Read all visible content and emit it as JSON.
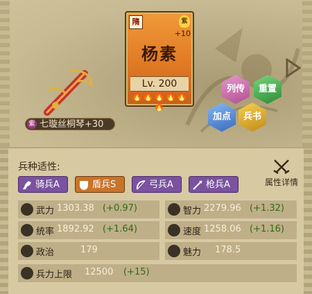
{
  "card": {
    "faction": "隋",
    "rank_badge": "紫",
    "plus": "+10",
    "name": "杨素",
    "level": "Lv. 200",
    "flames": "🔥🔥🔥🔥🔥🔥"
  },
  "equipment": {
    "badge": "紫",
    "name": "七璇丝桐琴+30"
  },
  "actions": {
    "biography": "列传",
    "reset": "重置",
    "add_points": "加点",
    "military_book": "兵书"
  },
  "troops": {
    "title": "兵种适性:",
    "detail_label": "属性详情",
    "types": [
      {
        "label": "骑兵A",
        "icon": "horse-icon"
      },
      {
        "label": "盾兵S",
        "icon": "shield-icon"
      },
      {
        "label": "弓兵A",
        "icon": "bow-icon"
      },
      {
        "label": "枪兵A",
        "icon": "spear-icon"
      }
    ]
  },
  "stats": {
    "force": {
      "label": "武力",
      "value": "1303.38",
      "bonus": "(+0.97)"
    },
    "intellect": {
      "label": "智力",
      "value": "2279.96",
      "bonus": "(+1.32)"
    },
    "command": {
      "label": "统率",
      "value": "1892.92",
      "bonus": "(+1.64)"
    },
    "speed": {
      "label": "速度",
      "value": "1258.06",
      "bonus": "(+1.16)"
    },
    "politics": {
      "label": "政治",
      "value": "179"
    },
    "charm": {
      "label": "魅力",
      "value": "178.5"
    },
    "troop_cap": {
      "label": "兵力上限",
      "value": "12500",
      "bonus": "(+15)"
    }
  },
  "colors": {
    "card_orange": "#e07a24",
    "tag_purple": "#7a52a0",
    "tag_orange": "#c9742a",
    "bonus_green": "#2e6a18"
  }
}
